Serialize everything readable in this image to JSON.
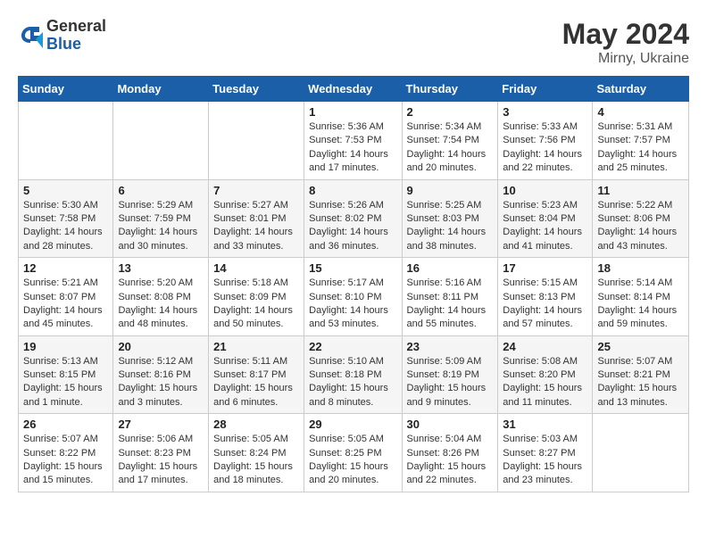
{
  "logo": {
    "general": "General",
    "blue": "Blue"
  },
  "title": {
    "month_year": "May 2024",
    "location": "Mirny, Ukraine"
  },
  "weekdays": [
    "Sunday",
    "Monday",
    "Tuesday",
    "Wednesday",
    "Thursday",
    "Friday",
    "Saturday"
  ],
  "weeks": [
    [
      {
        "day": "",
        "info": ""
      },
      {
        "day": "",
        "info": ""
      },
      {
        "day": "",
        "info": ""
      },
      {
        "day": "1",
        "info": "Sunrise: 5:36 AM\nSunset: 7:53 PM\nDaylight: 14 hours\nand 17 minutes."
      },
      {
        "day": "2",
        "info": "Sunrise: 5:34 AM\nSunset: 7:54 PM\nDaylight: 14 hours\nand 20 minutes."
      },
      {
        "day": "3",
        "info": "Sunrise: 5:33 AM\nSunset: 7:56 PM\nDaylight: 14 hours\nand 22 minutes."
      },
      {
        "day": "4",
        "info": "Sunrise: 5:31 AM\nSunset: 7:57 PM\nDaylight: 14 hours\nand 25 minutes."
      }
    ],
    [
      {
        "day": "5",
        "info": "Sunrise: 5:30 AM\nSunset: 7:58 PM\nDaylight: 14 hours\nand 28 minutes."
      },
      {
        "day": "6",
        "info": "Sunrise: 5:29 AM\nSunset: 7:59 PM\nDaylight: 14 hours\nand 30 minutes."
      },
      {
        "day": "7",
        "info": "Sunrise: 5:27 AM\nSunset: 8:01 PM\nDaylight: 14 hours\nand 33 minutes."
      },
      {
        "day": "8",
        "info": "Sunrise: 5:26 AM\nSunset: 8:02 PM\nDaylight: 14 hours\nand 36 minutes."
      },
      {
        "day": "9",
        "info": "Sunrise: 5:25 AM\nSunset: 8:03 PM\nDaylight: 14 hours\nand 38 minutes."
      },
      {
        "day": "10",
        "info": "Sunrise: 5:23 AM\nSunset: 8:04 PM\nDaylight: 14 hours\nand 41 minutes."
      },
      {
        "day": "11",
        "info": "Sunrise: 5:22 AM\nSunset: 8:06 PM\nDaylight: 14 hours\nand 43 minutes."
      }
    ],
    [
      {
        "day": "12",
        "info": "Sunrise: 5:21 AM\nSunset: 8:07 PM\nDaylight: 14 hours\nand 45 minutes."
      },
      {
        "day": "13",
        "info": "Sunrise: 5:20 AM\nSunset: 8:08 PM\nDaylight: 14 hours\nand 48 minutes."
      },
      {
        "day": "14",
        "info": "Sunrise: 5:18 AM\nSunset: 8:09 PM\nDaylight: 14 hours\nand 50 minutes."
      },
      {
        "day": "15",
        "info": "Sunrise: 5:17 AM\nSunset: 8:10 PM\nDaylight: 14 hours\nand 53 minutes."
      },
      {
        "day": "16",
        "info": "Sunrise: 5:16 AM\nSunset: 8:11 PM\nDaylight: 14 hours\nand 55 minutes."
      },
      {
        "day": "17",
        "info": "Sunrise: 5:15 AM\nSunset: 8:13 PM\nDaylight: 14 hours\nand 57 minutes."
      },
      {
        "day": "18",
        "info": "Sunrise: 5:14 AM\nSunset: 8:14 PM\nDaylight: 14 hours\nand 59 minutes."
      }
    ],
    [
      {
        "day": "19",
        "info": "Sunrise: 5:13 AM\nSunset: 8:15 PM\nDaylight: 15 hours\nand 1 minute."
      },
      {
        "day": "20",
        "info": "Sunrise: 5:12 AM\nSunset: 8:16 PM\nDaylight: 15 hours\nand 3 minutes."
      },
      {
        "day": "21",
        "info": "Sunrise: 5:11 AM\nSunset: 8:17 PM\nDaylight: 15 hours\nand 6 minutes."
      },
      {
        "day": "22",
        "info": "Sunrise: 5:10 AM\nSunset: 8:18 PM\nDaylight: 15 hours\nand 8 minutes."
      },
      {
        "day": "23",
        "info": "Sunrise: 5:09 AM\nSunset: 8:19 PM\nDaylight: 15 hours\nand 9 minutes."
      },
      {
        "day": "24",
        "info": "Sunrise: 5:08 AM\nSunset: 8:20 PM\nDaylight: 15 hours\nand 11 minutes."
      },
      {
        "day": "25",
        "info": "Sunrise: 5:07 AM\nSunset: 8:21 PM\nDaylight: 15 hours\nand 13 minutes."
      }
    ],
    [
      {
        "day": "26",
        "info": "Sunrise: 5:07 AM\nSunset: 8:22 PM\nDaylight: 15 hours\nand 15 minutes."
      },
      {
        "day": "27",
        "info": "Sunrise: 5:06 AM\nSunset: 8:23 PM\nDaylight: 15 hours\nand 17 minutes."
      },
      {
        "day": "28",
        "info": "Sunrise: 5:05 AM\nSunset: 8:24 PM\nDaylight: 15 hours\nand 18 minutes."
      },
      {
        "day": "29",
        "info": "Sunrise: 5:05 AM\nSunset: 8:25 PM\nDaylight: 15 hours\nand 20 minutes."
      },
      {
        "day": "30",
        "info": "Sunrise: 5:04 AM\nSunset: 8:26 PM\nDaylight: 15 hours\nand 22 minutes."
      },
      {
        "day": "31",
        "info": "Sunrise: 5:03 AM\nSunset: 8:27 PM\nDaylight: 15 hours\nand 23 minutes."
      },
      {
        "day": "",
        "info": ""
      }
    ]
  ]
}
